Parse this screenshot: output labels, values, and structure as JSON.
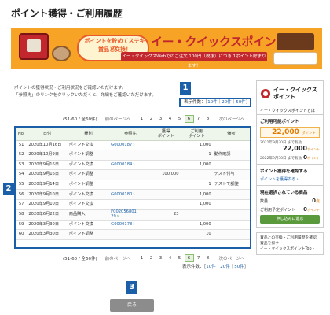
{
  "page": {
    "title": "ポイント獲得・ご利用履歴"
  },
  "banner": {
    "bubble_line1": "ポイントを貯めてステキな",
    "bubble_line2": "賞品と交換！",
    "headline": "イー・クイックスポイント",
    "subline": "イー・クイックスWebでのご注文 100円（税抜）につき 1ポイント貯まります！"
  },
  "intro": {
    "line1": "ポイントの獲得状況・ご利用状況をご確認いただけます。",
    "line2": "「参照先」のリンクをクリックいただくと、詳細をご確認いただけます。"
  },
  "annotations": {
    "b1": "1",
    "b2": "2",
    "b3": "3"
  },
  "count_selector": {
    "label": "表示件数：［",
    "opt10": "10件",
    "opt20": "20件",
    "opt50": "50件",
    "sep": "｜",
    "close": "］"
  },
  "pager": {
    "range": "(51-60 / 全60件)",
    "prev": "前のページへ",
    "pages": [
      "1",
      "2",
      "3",
      "4",
      "5",
      "6",
      "7",
      "8"
    ],
    "current": "6",
    "next": "次のページへ"
  },
  "table": {
    "headers": {
      "no": "No.",
      "date": "日付",
      "type": "種別",
      "ref": "参照先",
      "earned": "獲得\nポイント",
      "used": "ご利用\nポイント",
      "note": "備考"
    },
    "rows": [
      {
        "no": "51",
        "date": "2020年10月16日",
        "type": "ポイント交換",
        "ref": "G0000187",
        "ref_arrow": "›",
        "earned": "",
        "used": "1,000",
        "note": ""
      },
      {
        "no": "52",
        "date": "2020年10月9日",
        "type": "ポイント調整",
        "ref": "",
        "ref_arrow": "",
        "earned": "",
        "used": "1",
        "note": "動作確認"
      },
      {
        "no": "53",
        "date": "2020年9月16日",
        "type": "ポイント交換",
        "ref": "G0000184",
        "ref_arrow": "›",
        "earned": "",
        "used": "1,000",
        "note": ""
      },
      {
        "no": "54",
        "date": "2020年9月16日",
        "type": "ポイント調整",
        "ref": "",
        "ref_arrow": "",
        "earned": "100,000",
        "used": "",
        "note": "テスト付与"
      },
      {
        "no": "55",
        "date": "2020年9月14日",
        "type": "ポイント調整",
        "ref": "",
        "ref_arrow": "",
        "earned": "",
        "used": "1",
        "note": "テストで調整"
      },
      {
        "no": "56",
        "date": "2020年9月10日",
        "type": "ポイント交換",
        "ref": "G0000180",
        "ref_arrow": "›",
        "earned": "",
        "used": "1,000",
        "note": ""
      },
      {
        "no": "57",
        "date": "2020年9月10日",
        "type": "ポイント交換",
        "ref": "",
        "ref_arrow": "",
        "earned": "",
        "used": "1,000",
        "note": ""
      },
      {
        "no": "58",
        "date": "2020年6月22日",
        "type": "商品購入",
        "ref": "F002056801\n29",
        "ref_arrow": "›",
        "earned": "23",
        "used": "",
        "note": ""
      },
      {
        "no": "59",
        "date": "2020年3月30日",
        "type": "ポイント交換",
        "ref": "G0000178",
        "ref_arrow": "›",
        "earned": "",
        "used": "1,000",
        "note": ""
      },
      {
        "no": "60",
        "date": "2020年3月30日",
        "type": "ポイント調整",
        "ref": "",
        "ref_arrow": "",
        "earned": "",
        "used": "10",
        "note": ""
      }
    ]
  },
  "back_button": {
    "label": "戻る"
  },
  "sidebar": {
    "brand_line1": "イー・クイックス",
    "brand_line2": "ポイント",
    "about_link": "イー・クイックスポイントとは ›",
    "available_label": "ご利用可能ポイント",
    "available_value": "22,000",
    "unit": "ポイント",
    "exp1_date": "2021年9月30日 まで有効",
    "exp1_value": "22,000",
    "exp2_date": "2022年9月30日 まで有効",
    "exp2_value": "0",
    "pending_label": "ポイント獲得を確認する",
    "pending_link": "ポイントを獲得する ›",
    "selected_label": "現在選択されている商品",
    "count_label": "数量",
    "count_value": "0",
    "count_unit": "点",
    "need_label": "ご利用予定ポイント",
    "need_value": "0",
    "apply_button": "申し込みに進む",
    "foot_line1": "賞品との交換・ご利用履歴を確認",
    "foot_line2": "賞品を探す",
    "foot_line3": "イー・クイックスポイントTop ›"
  },
  "colors": {
    "accent_blue": "#1a5fa8",
    "orange": "#e07a00",
    "green": "#5a9a3c"
  }
}
